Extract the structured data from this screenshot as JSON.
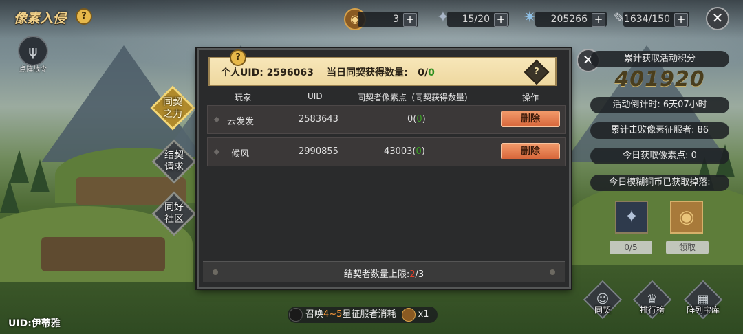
{
  "header": {
    "title": "像素入侵",
    "help": "?",
    "resources": [
      {
        "icon": "coin-icon",
        "value": "3"
      },
      {
        "icon": "dark-crest-icon",
        "value": "15/20"
      },
      {
        "icon": "star-gear-icon",
        "value": "205266"
      },
      {
        "icon": "feather-icon",
        "value": "1634/150"
      }
    ],
    "plus": "+",
    "close": "✕"
  },
  "formation": {
    "label": "点阵战令"
  },
  "tabs": [
    {
      "label": "同契\n之力",
      "active": true
    },
    {
      "label": "结契\n请求",
      "active": false
    },
    {
      "label": "同好\n社区",
      "active": false
    }
  ],
  "panel": {
    "help_badge": "?",
    "uid_label": "个人UID:",
    "uid_value": "2596063",
    "daily_label": "当日同契获得数量:",
    "daily_current": "0",
    "daily_sep": "/",
    "daily_max": "0",
    "info_help": "?",
    "columns": [
      "玩家",
      "UID",
      "同契者像素点（同契获得数量）",
      "操作"
    ],
    "rows": [
      {
        "name": "云发发",
        "uid": "2583643",
        "points": "0",
        "gain": "0",
        "action": "删除"
      },
      {
        "name": "候风",
        "uid": "2990855",
        "points": "43003",
        "gain": "0",
        "action": "删除"
      }
    ],
    "footer_label": "结契者数量上限:",
    "footer_current": "2",
    "footer_max": "/3"
  },
  "right": {
    "close": "✕",
    "score_label": "累计获取活动积分",
    "score": "401920",
    "countdown": "活动倒计时:  6天07小时",
    "defeated": "累计击败像素征服者:  86",
    "today_points": "今日获取像素点:  0",
    "today_coins": "今日模糊铜币已获取掉落:",
    "rewards": [
      {
        "icon": "dark-crest-icon",
        "label": "0/5"
      },
      {
        "icon": "bronze-coin-icon",
        "label": "领取"
      }
    ]
  },
  "bottom": {
    "uid_user": "UID:伊蒂雅",
    "summon_pre": "召唤",
    "summon_range": "4~5",
    "summon_post": "星征服者消耗",
    "summon_count": "x1",
    "nav": [
      {
        "label": "同契",
        "icon": "person-icon"
      },
      {
        "label": "排行榜",
        "icon": "trophy-icon"
      },
      {
        "label": "阵列宝库",
        "icon": "treasure-icon"
      }
    ]
  },
  "colors": {
    "accent": "#f0d089",
    "green": "#3aa124",
    "red": "#e0412c",
    "delete": "#d7663a"
  }
}
